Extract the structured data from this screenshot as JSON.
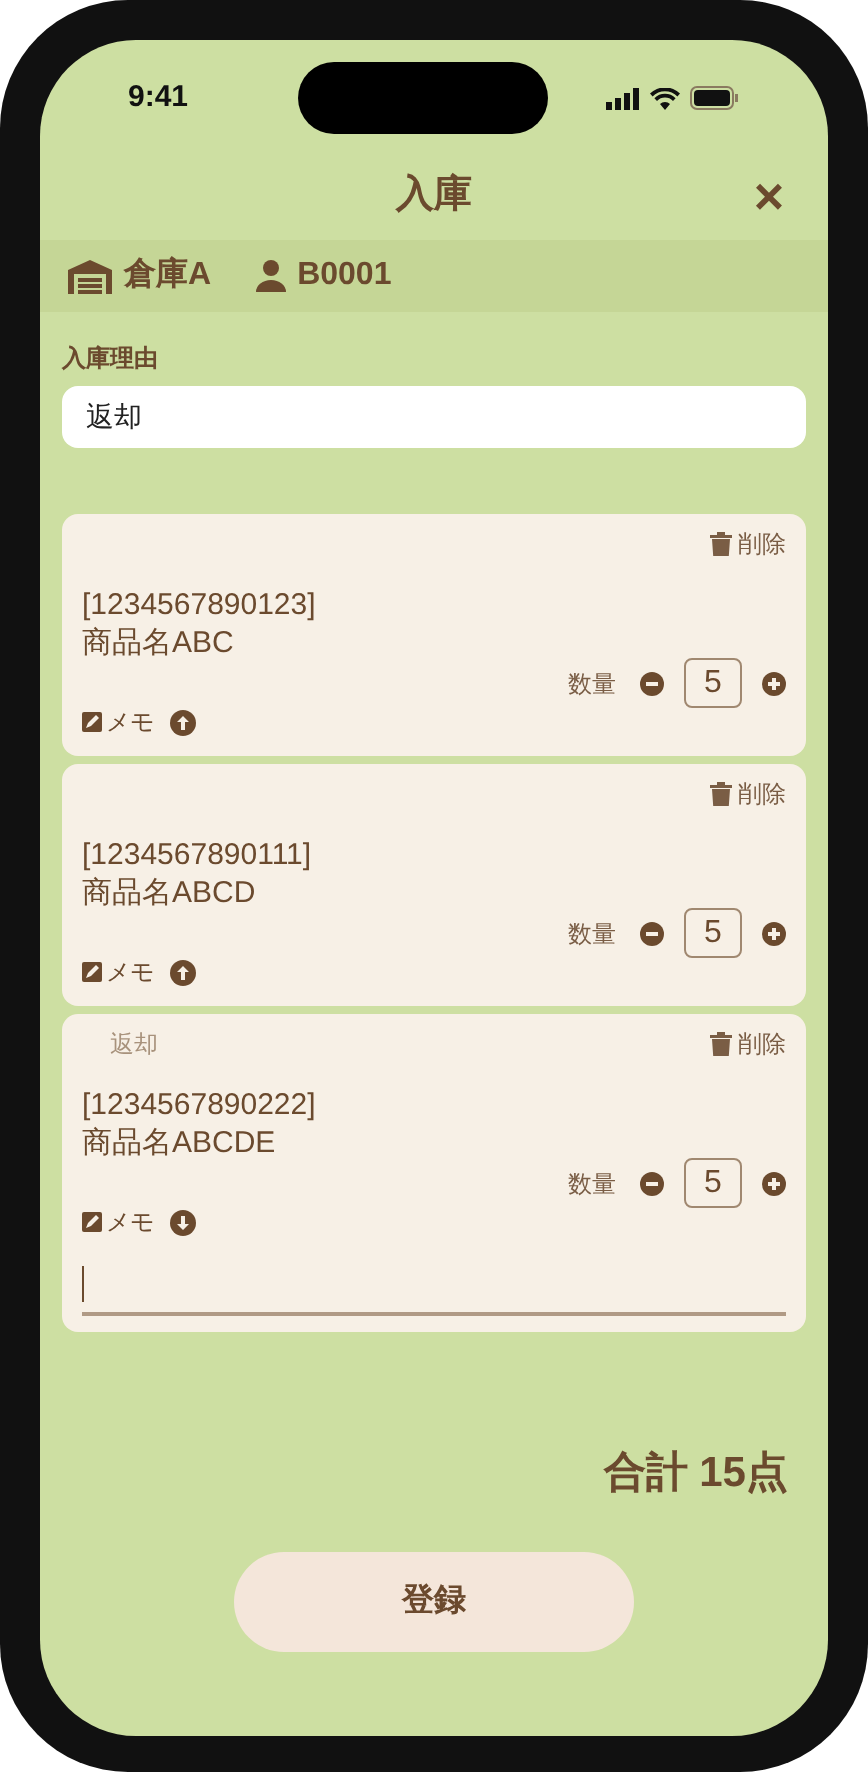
{
  "status_bar": {
    "time": "9:41"
  },
  "header": {
    "title": "入庫",
    "close_label": "×"
  },
  "info_bar": {
    "warehouse": "倉庫A",
    "user": "B0001"
  },
  "reason": {
    "label": "入庫理由",
    "value": "返却"
  },
  "items": [
    {
      "code": "[1234567890123]",
      "name": "商品名ABC",
      "delete_label": "削除",
      "qty_label": "数量",
      "qty": "5",
      "memo_label": "メモ",
      "memo_expanded": false
    },
    {
      "code": "[1234567890111]",
      "name": "商品名ABCD",
      "delete_label": "削除",
      "qty_label": "数量",
      "qty": "5",
      "memo_label": "メモ",
      "memo_expanded": false
    },
    {
      "ghost_label": "返却",
      "code": "[1234567890222]",
      "name": "商品名ABCDE",
      "delete_label": "削除",
      "qty_label": "数量",
      "qty": "5",
      "memo_label": "メモ",
      "memo_expanded": true
    }
  ],
  "total": "合計 15点",
  "submit_button": "登録"
}
